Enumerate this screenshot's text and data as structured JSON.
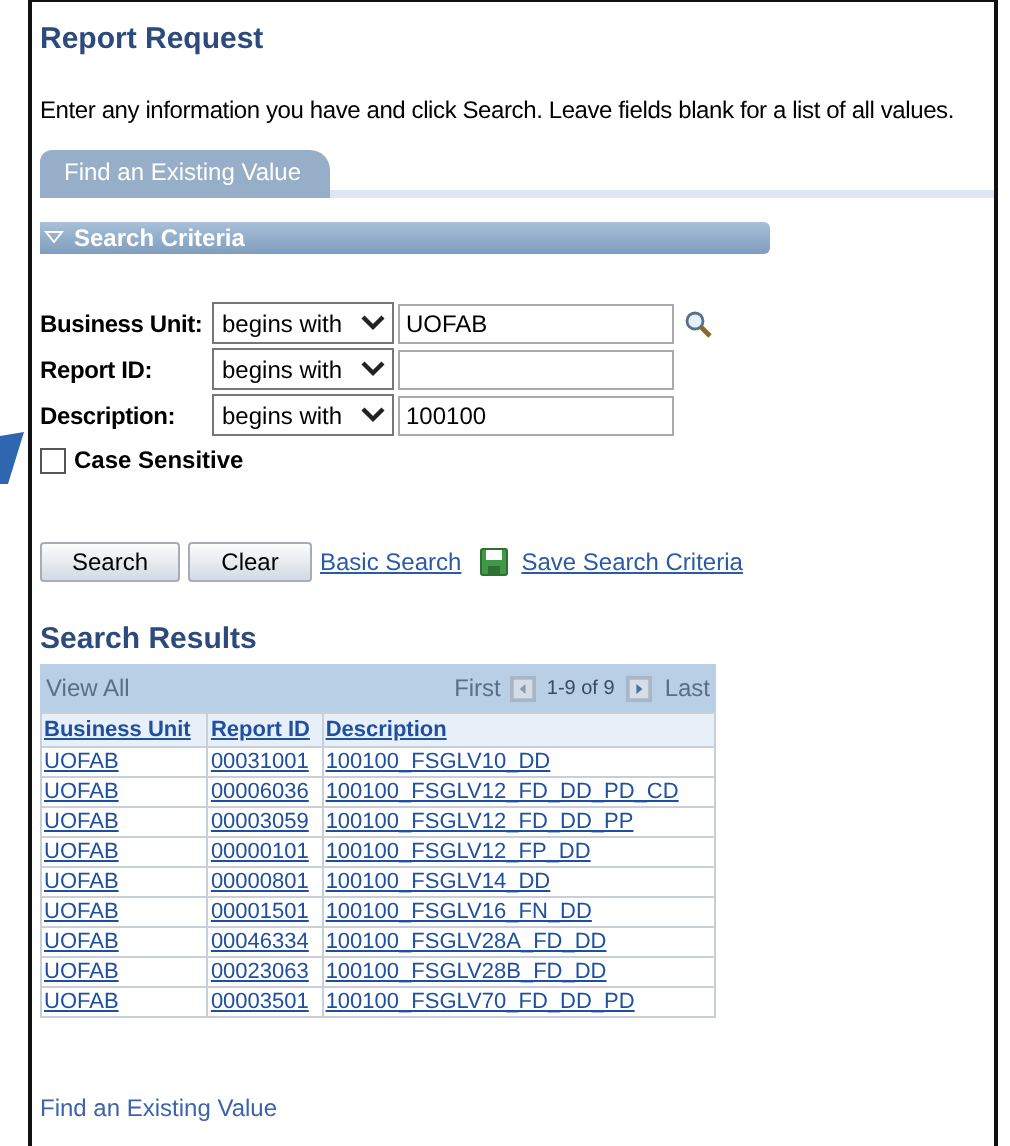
{
  "page": {
    "title": "Report Request",
    "instructions": "Enter any information you have and click Search. Leave fields blank for a list of all values."
  },
  "tabs": [
    {
      "label": "Find an Existing Value",
      "selected": true
    }
  ],
  "search_criteria": {
    "title": "Search Criteria",
    "expanded": true,
    "fields": [
      {
        "label": "Business Unit:",
        "operator": "begins with",
        "value": "UOFAB",
        "lookup": true
      },
      {
        "label": "Report ID:",
        "operator": "begins with",
        "lookup": false
      },
      {
        "label": "Description:",
        "operator": "begins with",
        "value": "100100",
        "lookup": false
      }
    ],
    "case_sensitive": {
      "label": "Case Sensitive",
      "checked": false
    }
  },
  "buttons": [
    "Search",
    "Clear"
  ],
  "links": [
    {
      "label": "Basic Search",
      "kind": "plain"
    },
    {
      "label": "Save Search Criteria",
      "kind": "save"
    }
  ],
  "results": {
    "title": "Search Results",
    "view_all": "View All",
    "first": "First",
    "range": "1-9 of 9",
    "last": "Last",
    "columns": [
      "Business Unit",
      "Report ID",
      "Description"
    ],
    "rows": [
      [
        "UOFAB",
        "00031001",
        "100100_FSGLV10_DD"
      ],
      [
        "UOFAB",
        "00006036",
        "100100_FSGLV12_FD_DD_PD_CD"
      ],
      [
        "UOFAB",
        "00003059",
        "100100_FSGLV12_FD_DD_PP"
      ],
      [
        "UOFAB",
        "00000101",
        "100100_FSGLV12_FP_DD"
      ],
      [
        "UOFAB",
        "00000801",
        "100100_FSGLV14_DD"
      ],
      [
        "UOFAB",
        "00001501",
        "100100_FSGLV16_FN_DD"
      ],
      [
        "UOFAB",
        "00046334",
        "100100_FSGLV28A_FD_DD"
      ],
      [
        "UOFAB",
        "00023063",
        "100100_FSGLV28B_FD_DD"
      ],
      [
        "UOFAB",
        "00003501",
        "100100_FSGLV70_FD_DD_PD"
      ]
    ]
  },
  "footer_link": "Find an Existing Value"
}
